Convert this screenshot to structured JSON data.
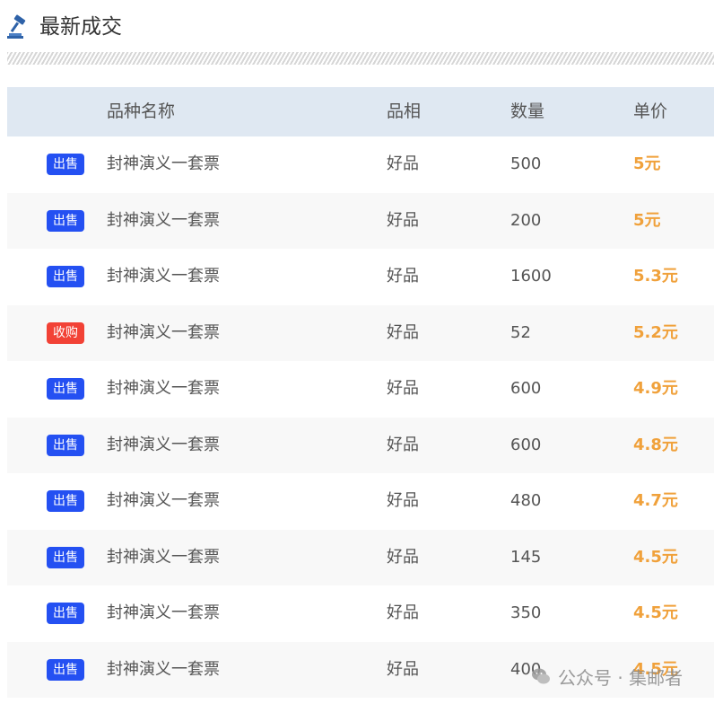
{
  "header": {
    "title": "最新成交",
    "icon": "gavel-icon"
  },
  "table": {
    "columns": [
      "品种名称",
      "品相",
      "数量",
      "单价"
    ],
    "rows": [
      {
        "type": "出售",
        "type_color": "#2450f2",
        "name": "封神演义一套票",
        "quality": "好品",
        "quantity": "500",
        "price": "5元"
      },
      {
        "type": "出售",
        "type_color": "#2450f2",
        "name": "封神演义一套票",
        "quality": "好品",
        "quantity": "200",
        "price": "5元"
      },
      {
        "type": "出售",
        "type_color": "#2450f2",
        "name": "封神演义一套票",
        "quality": "好品",
        "quantity": "1600",
        "price": "5.3元"
      },
      {
        "type": "收购",
        "type_color": "#f24236",
        "name": "封神演义一套票",
        "quality": "好品",
        "quantity": "52",
        "price": "5.2元"
      },
      {
        "type": "出售",
        "type_color": "#2450f2",
        "name": "封神演义一套票",
        "quality": "好品",
        "quantity": "600",
        "price": "4.9元"
      },
      {
        "type": "出售",
        "type_color": "#2450f2",
        "name": "封神演义一套票",
        "quality": "好品",
        "quantity": "600",
        "price": "4.8元"
      },
      {
        "type": "出售",
        "type_color": "#2450f2",
        "name": "封神演义一套票",
        "quality": "好品",
        "quantity": "480",
        "price": "4.7元"
      },
      {
        "type": "出售",
        "type_color": "#2450f2",
        "name": "封神演义一套票",
        "quality": "好品",
        "quantity": "145",
        "price": "4.5元"
      },
      {
        "type": "出售",
        "type_color": "#2450f2",
        "name": "封神演义一套票",
        "quality": "好品",
        "quantity": "350",
        "price": "4.5元"
      },
      {
        "type": "出售",
        "type_color": "#2450f2",
        "name": "封神演义一套票",
        "quality": "好品",
        "quantity": "400",
        "price": "4.5元"
      }
    ]
  },
  "watermark": {
    "text": "公众号 · 集邮者",
    "icon": "wechat-icon"
  },
  "colors": {
    "sell_badge": "#2450f2",
    "buy_badge": "#f24236",
    "price": "#f0a13b",
    "header_row": "#dfe8f2"
  }
}
